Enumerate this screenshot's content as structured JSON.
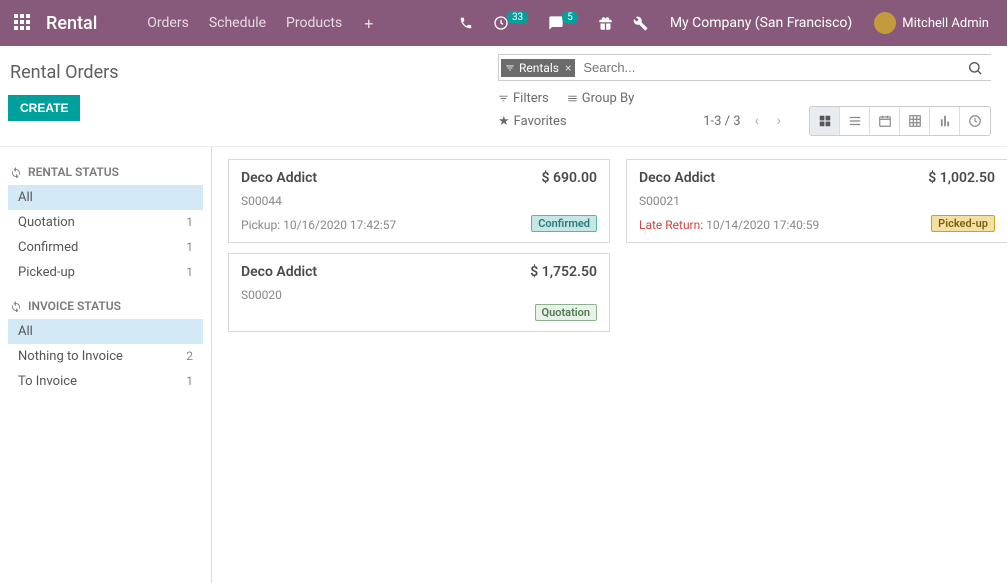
{
  "topbar": {
    "brand": "Rental",
    "nav": [
      "Orders",
      "Schedule",
      "Products"
    ],
    "clock_badge": "33",
    "chat_badge": "5",
    "company": "My Company (San Francisco)",
    "user": "Mitchell Admin"
  },
  "header": {
    "title": "Rental Orders",
    "create_label": "CREATE",
    "filter_tag": "Rentals",
    "search_placeholder": "Search...",
    "filters_label": "Filters",
    "groupby_label": "Group By",
    "favorites_label": "Favorites",
    "pager": "1-3 / 3"
  },
  "sidebar": {
    "section1_title": "RENTAL STATUS",
    "section1_items": [
      {
        "label": "All",
        "count": "",
        "active": true
      },
      {
        "label": "Quotation",
        "count": "1"
      },
      {
        "label": "Confirmed",
        "count": "1"
      },
      {
        "label": "Picked-up",
        "count": "1"
      }
    ],
    "section2_title": "INVOICE STATUS",
    "section2_items": [
      {
        "label": "All",
        "count": "",
        "active": true
      },
      {
        "label": "Nothing to Invoice",
        "count": "2"
      },
      {
        "label": "To Invoice",
        "count": "1"
      }
    ]
  },
  "cards": [
    {
      "name": "Deco Addict",
      "amount": "$ 690.00",
      "ref": "S00044",
      "pickup_label": "Pickup:",
      "pickup": "10/16/2020 17:42:57",
      "status": "Confirmed",
      "status_class": "st-confirmed"
    },
    {
      "name": "Deco Addict",
      "amount": "$ 1,752.50",
      "ref": "S00020",
      "pickup_label": "",
      "pickup": "",
      "status": "Quotation",
      "status_class": "st-quotation"
    },
    {
      "name": "Deco Addict",
      "amount": "$ 1,002.50",
      "ref": "S00021",
      "pickup_label": "Late Return:",
      "pickup": "10/14/2020 17:40:59",
      "status": "Picked-up",
      "status_class": "st-picked",
      "late": true
    }
  ]
}
